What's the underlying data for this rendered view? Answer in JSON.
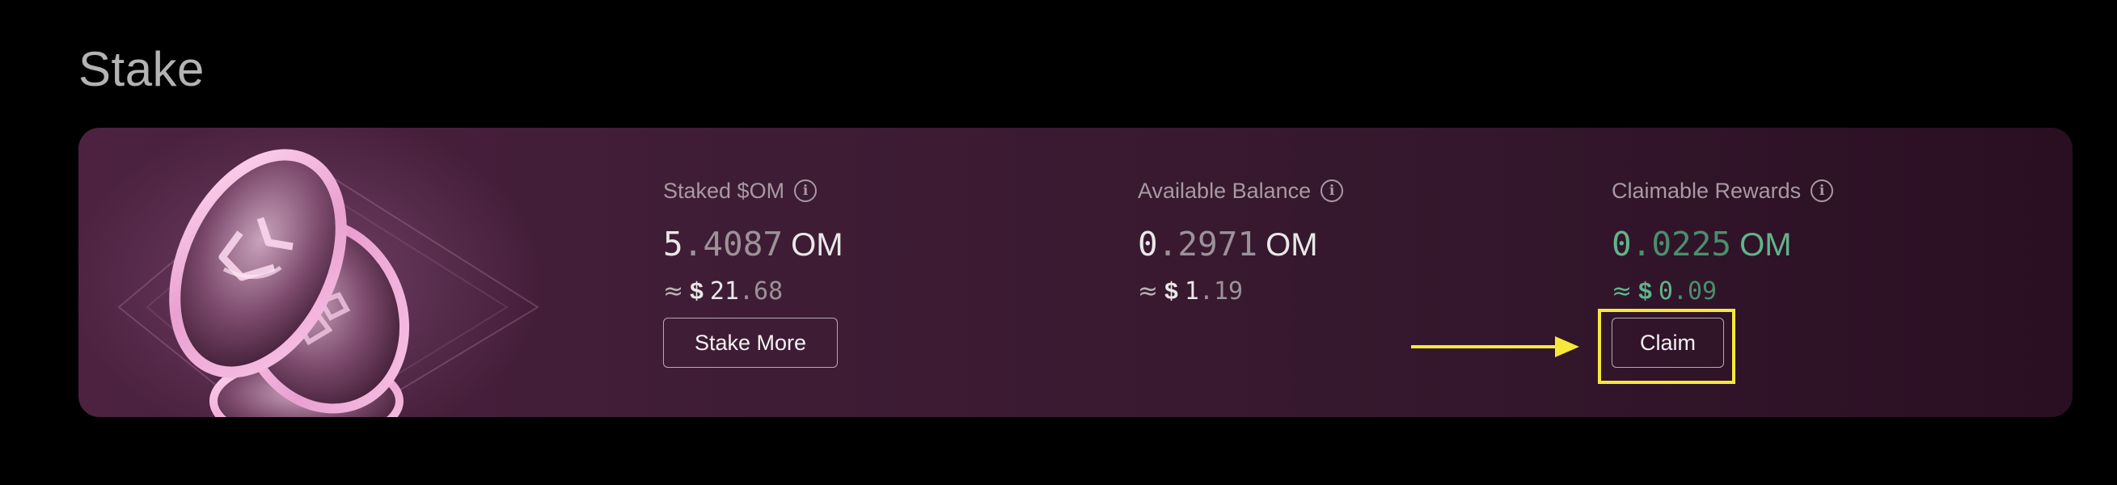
{
  "page": {
    "title": "Stake"
  },
  "colors": {
    "background": "#000000",
    "card_start": "#4c2240",
    "card_end": "#2a0e22",
    "rewards_green": "#5fb58a",
    "annotation_yellow": "#f4e93a"
  },
  "stats": {
    "staked": {
      "label": "Staked $OM",
      "amount_int": "5",
      "amount_frac": ".4087",
      "unit": "OM",
      "approx": "≈",
      "usd_symbol": "$",
      "usd_int": "21",
      "usd_frac": ".68"
    },
    "available": {
      "label": "Available Balance",
      "amount_int": "0",
      "amount_frac": ".2971",
      "unit": "OM",
      "approx": "≈",
      "usd_symbol": "$",
      "usd_int": "1",
      "usd_frac": ".19"
    },
    "rewards": {
      "label": "Claimable Rewards",
      "amount_int": "0",
      "amount_frac": ".0225",
      "unit": "OM",
      "approx": "≈",
      "usd_symbol": "$",
      "usd_int": "0",
      "usd_frac": ".09"
    }
  },
  "buttons": {
    "stake_more": "Stake More",
    "claim": "Claim"
  },
  "icons": {
    "info": "info-icon",
    "info_glyph": "i",
    "art": "om-coin-stack-illustration",
    "annotation": "arrow-right-icon"
  }
}
